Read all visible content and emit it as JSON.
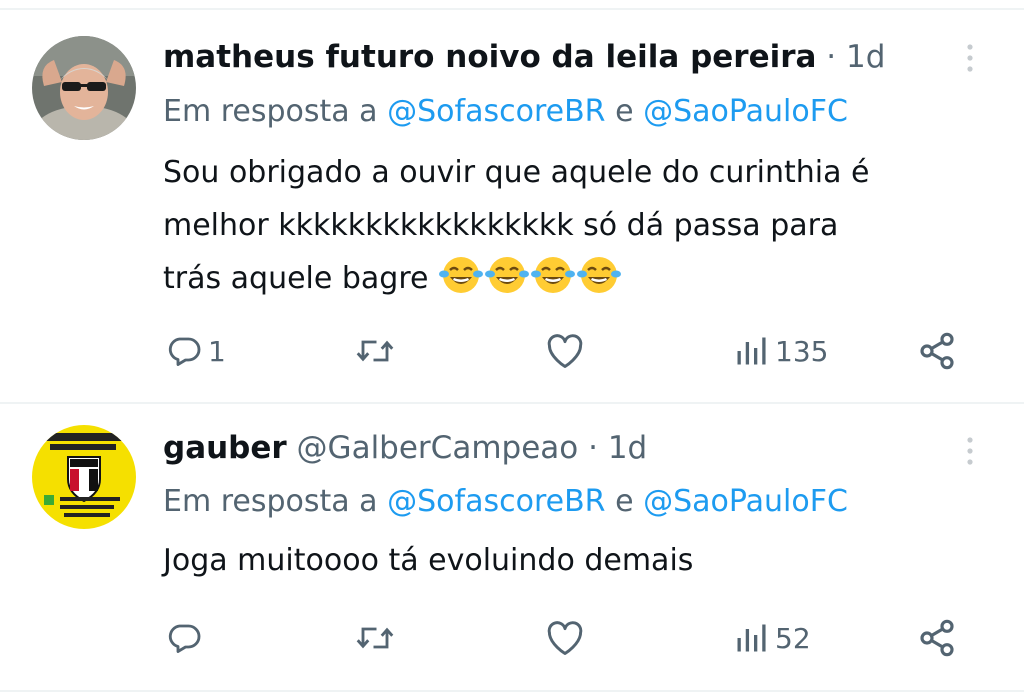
{
  "tweets": [
    {
      "display_name": "matheus futuro noivo da leila pereira",
      "handle": "",
      "separator": "·",
      "time": "1d",
      "reply_prefix": "Em resposta a",
      "reply_mention_1": "@SofascoreBR",
      "reply_conj": "e",
      "reply_mention_2": "@SaoPauloFC",
      "text_line_1": "Sou obrigado a ouvir que aquele do curinthia é",
      "text_line_2": "melhor kkkkkkkkkkkkkkkkk só dá passa para",
      "text_line_3": "trás aquele bagre",
      "emojis": [
        "face-with-tears-of-joy-icon",
        "face-with-tears-of-joy-icon",
        "face-with-tears-of-joy-icon",
        "face-with-tears-of-joy-icon"
      ],
      "reply_count": "1",
      "retweet_count": "",
      "like_count": "",
      "view_count": "135"
    },
    {
      "display_name": "gauber",
      "handle": "@GalberCampeao",
      "separator": "·",
      "time": "1d",
      "reply_prefix": "Em resposta a",
      "reply_mention_1": "@SofascoreBR",
      "reply_conj": "e",
      "reply_mention_2": "@SaoPauloFC",
      "text_line_1": "Joga muitoooo tá evoluindo demais",
      "reply_count": "",
      "retweet_count": "",
      "like_count": "",
      "view_count": "52"
    }
  ],
  "colors": {
    "text_primary": "#0f1419",
    "text_secondary": "#536471",
    "mention": "#1d9bf0",
    "divider": "#eff3f4"
  }
}
